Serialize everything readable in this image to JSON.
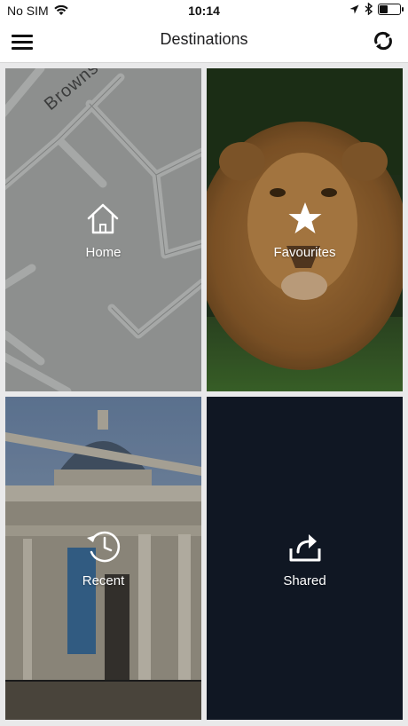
{
  "status_bar": {
    "carrier": "No SIM",
    "time": "10:14",
    "icons": [
      "wifi-icon",
      "location-arrow-icon",
      "bluetooth-icon",
      "battery-icon"
    ]
  },
  "nav": {
    "title": "Destinations",
    "left_icon": "menu-icon",
    "right_icon": "refresh-icon"
  },
  "map": {
    "street_label": "Browns La"
  },
  "tiles": [
    {
      "label": "Home",
      "icon": "home-icon"
    },
    {
      "label": "Favourites",
      "icon": "star-icon"
    },
    {
      "label": "Recent",
      "icon": "clock-history-icon"
    },
    {
      "label": "Shared",
      "icon": "share-icon"
    }
  ],
  "colors": {
    "shared_tile_bg": "#101723",
    "map_bg": "#8d8f8e",
    "header_bg": "#ffffff"
  }
}
